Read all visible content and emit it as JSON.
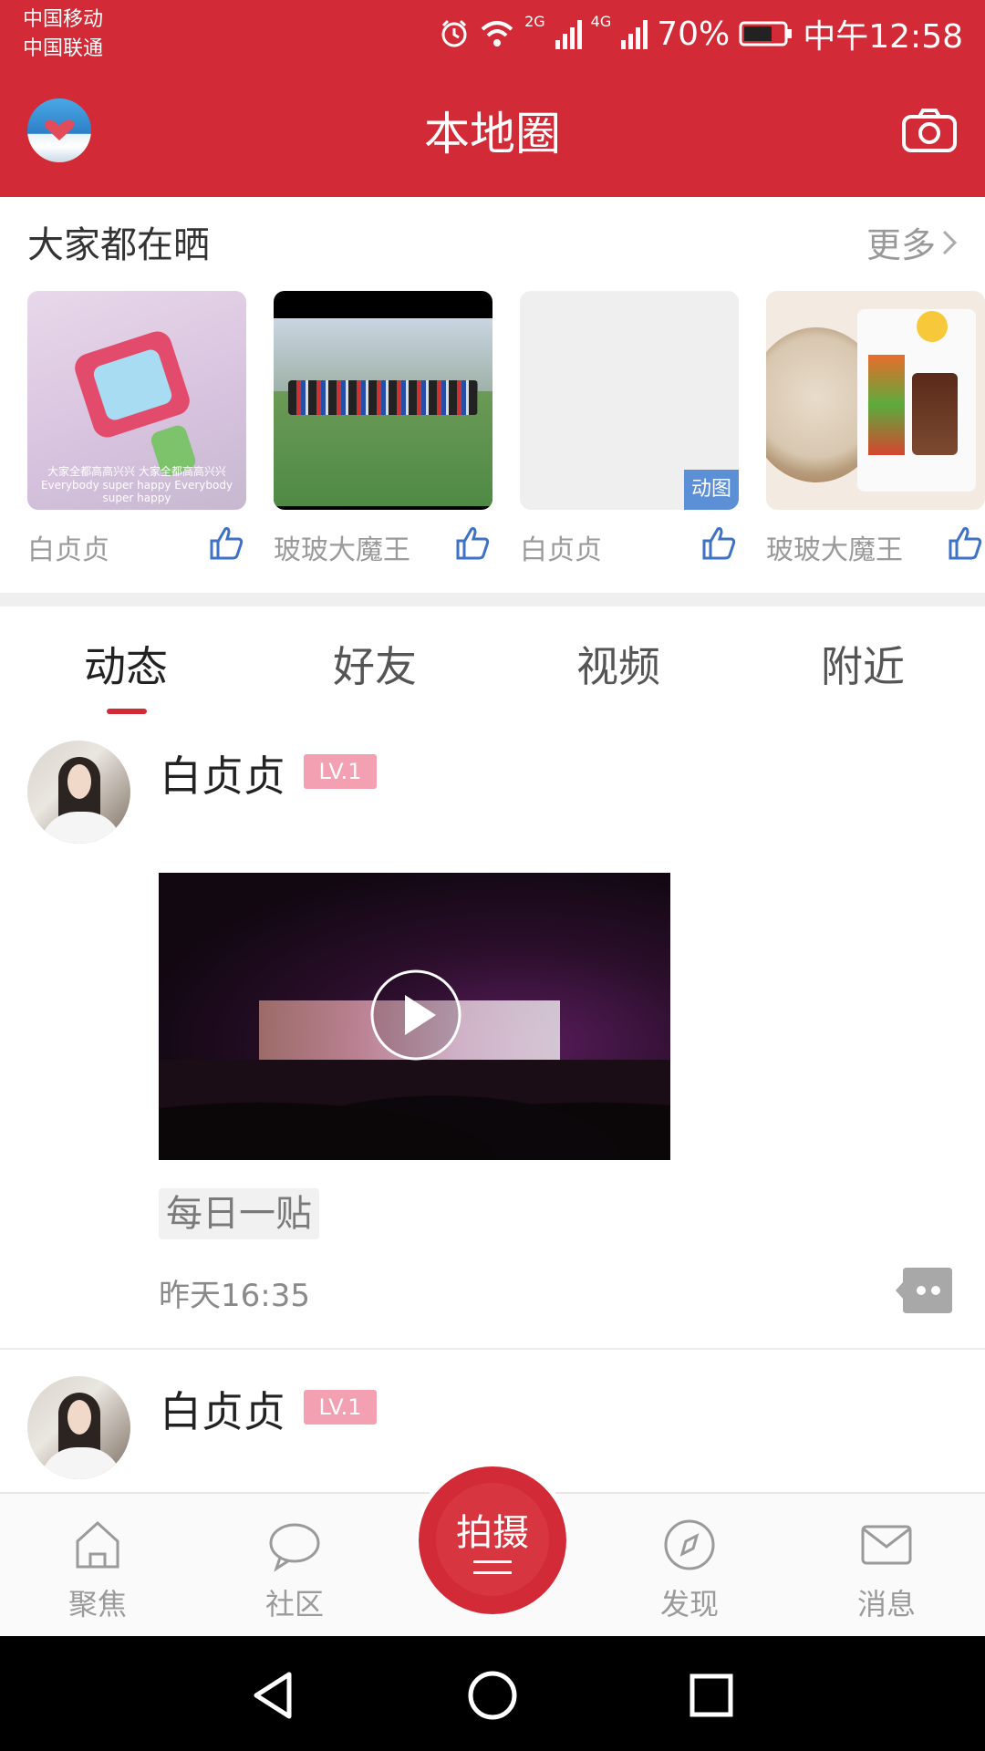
{
  "status_bar": {
    "carrier1": "中国移动",
    "carrier2": "中国联通",
    "network1": "2G",
    "network2": "4G",
    "battery": "70%",
    "time": "中午12:58",
    "icons": [
      "alarm-icon",
      "wifi-icon",
      "signal-icon",
      "battery-icon"
    ]
  },
  "header": {
    "title": "本地圈",
    "accent_color": "#D22B37"
  },
  "share_section": {
    "title": "大家都在晒",
    "more_label": "更多",
    "items": [
      {
        "author": "白贞贞",
        "caption": "大家全都高高兴兴 大家全都高高兴兴 Everybody super happy Everybody super happy"
      },
      {
        "author": "玻玻大魔王"
      },
      {
        "author": "白贞贞",
        "badge": "动图"
      },
      {
        "author": "玻玻大魔王"
      }
    ]
  },
  "tabs": [
    "动态",
    "好友",
    "视频",
    "附近"
  ],
  "feed": {
    "posts": [
      {
        "username": "白贞贞",
        "level": "LV.1",
        "tag": "每日一贴",
        "time": "昨天16:35"
      },
      {
        "username": "白贞贞",
        "level": "LV.1"
      }
    ]
  },
  "bottom_nav": {
    "items": [
      {
        "label": "聚焦",
        "icon": "home-icon"
      },
      {
        "label": "社区",
        "icon": "chat-icon"
      },
      {
        "label": "拍摄",
        "icon": "shoot-icon"
      },
      {
        "label": "发现",
        "icon": "compass-icon"
      },
      {
        "label": "消息",
        "icon": "mail-icon"
      }
    ]
  }
}
